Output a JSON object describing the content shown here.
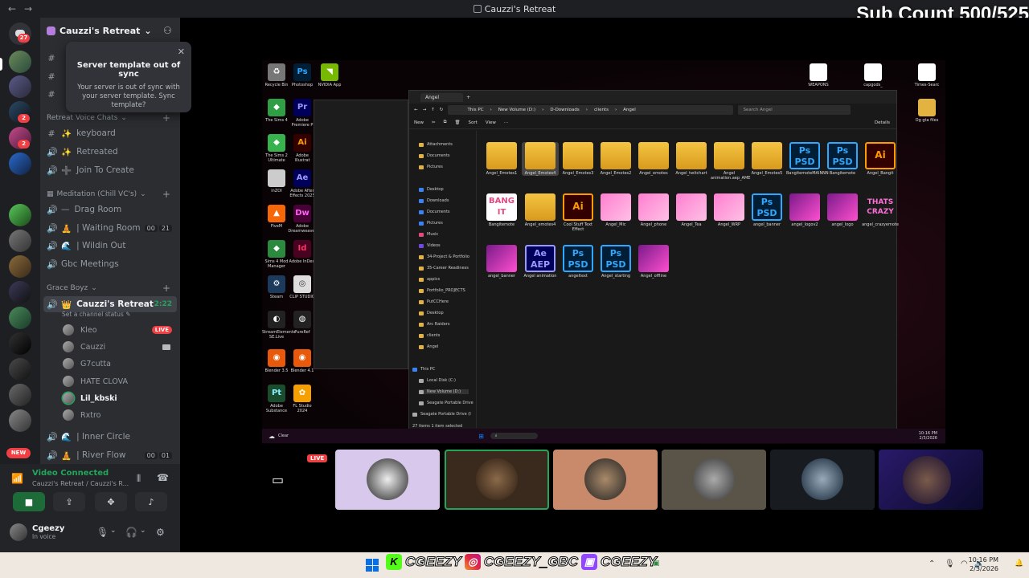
{
  "window": {
    "title": "Cauzzi's Retreat",
    "overlay": "Sub Count 500/525"
  },
  "servers": {
    "dm_badge": "27",
    "badges": [
      "2",
      "2"
    ],
    "new_label": "NEW"
  },
  "header": {
    "server_name": "Cauzzi's Retreat"
  },
  "popup": {
    "title": "Server template out of sync",
    "description": "Your server is out of sync with your server template. Sync template?"
  },
  "channels": {
    "cat1": "Retreat Voice Chats",
    "keyboard": "keyboard",
    "retreated": "Retreated",
    "join": "Join To Create",
    "cat2": "Meditation (Chill VC's)",
    "drag": "Drag Room",
    "waiting": "| Waiting Room",
    "waiting_counts": [
      "00",
      "21"
    ],
    "wildin": "| Wildin Out",
    "gbc": "Gbc Meetings",
    "cat3": "Grace Boyz",
    "active": "Cauzzi's Retreat",
    "active_time": "2:22",
    "status": "Set a channel status",
    "users": [
      "Kleo",
      "Cauzzi",
      "G7cutta",
      "HATE CLOVA",
      "Lil_kbski",
      "Rxtro"
    ],
    "live": "LIVE",
    "inner": "| Inner Circle",
    "river": "| River Flow",
    "river_counts": [
      "00",
      "01"
    ]
  },
  "voice": {
    "connected": "Video Connected",
    "location": "Cauzzi's Retreat / Cauzzi's R..."
  },
  "user": {
    "name": "Cgeezy",
    "status": "In voice"
  },
  "explorer": {
    "tab": "Angel",
    "path": [
      "This PC",
      "New Volume (D:)",
      "D-Downloads",
      "clients",
      "Angel"
    ],
    "search": "Search Angel",
    "toolbar": [
      "New",
      "Sort",
      "View",
      "Details"
    ],
    "nav": [
      "Attachments",
      "Documents",
      "Pictures",
      "Desktop",
      "Downloads",
      "Documents",
      "Pictures",
      "Music",
      "Videos",
      "34-Project & Portfolio",
      "35-Career Readiness",
      "appics",
      "Portfolio_PROJECTS",
      "PutCCHere",
      "Desktop",
      "Arc Raiders",
      "clients",
      "Angel",
      "This PC",
      "Local Disk (C:)",
      "New Volume (D:)",
      "Seagate Portable Drive",
      "Seagate Portable Drive (I"
    ],
    "files_row1": [
      "Angel_Emotes1",
      "Angel_Emotes4",
      "Angel_Emotes3",
      "Angel_Emotes2",
      "Angel_emotes",
      "Angel_twitchart",
      "Angel animation.aep_AME",
      "Angel_Emotes5",
      "BangitemoteMAINNN",
      "Bangitemote",
      "Angel_Bangit"
    ],
    "files_row2": [
      "Bangitemote",
      "Angel_emotes4",
      "Cool Stuff Text Effect",
      "Angel_Mic",
      "Angel_phone",
      "Angel_Tea",
      "Angel_WRP",
      "angel_banner",
      "angel_logov2",
      "angel_logo",
      "angel_crazyemote"
    ],
    "files_row3": [
      "angel_banner",
      "Angel animation",
      "angeltext",
      "Angel_starting",
      "Angel_offline"
    ],
    "status": "27 items   1 item selected"
  },
  "desktop": {
    "icons_left": [
      "Recycle Bin",
      "The Sims 4",
      "The Sims 2 Ultimate",
      "inZOI",
      "FiveM",
      "Sims 4 Mod Manager",
      "Steam",
      "StreamElements SE.Live",
      "Blender 3.5",
      "Adobe Substance"
    ],
    "icons_col2": [
      "Photoshop",
      "Adobe Premiere P",
      "Adobe Illustrat",
      "Adobe After Effects 2025",
      "Adobe Dreamweaver",
      "Adobe InDesi",
      "CLIP STUDIO",
      "PureRef",
      "Blender 4.1",
      "FL Studio 2024"
    ],
    "icons_right": [
      "WEAPONS",
      "capgods_",
      "Times-Searc",
      "Og gta files"
    ],
    "nvidia": "NVIDIA App",
    "weather": "Clear",
    "time": "10:16 PM",
    "date": "2/3/2026"
  },
  "tiles": {
    "live": "LIVE"
  },
  "banner": {
    "kick": "CGEEZY",
    "ig": "CGEEZY_GBC",
    "twitch": "CGEEZY"
  },
  "clock": {
    "time": "10:16 PM",
    "date": "2/3/2026"
  }
}
